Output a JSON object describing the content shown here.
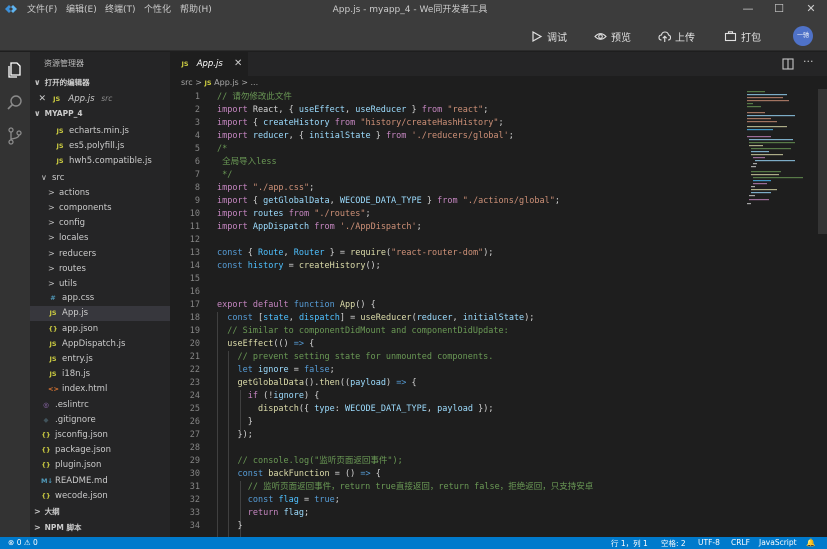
{
  "titlebar": {
    "menus": [
      "文件(F)",
      "编辑(E)",
      "终端(T)",
      "个性化",
      "帮助(H)"
    ],
    "title": "App.js - myapp_4 - We同开发者工具"
  },
  "toolbar": {
    "debug_label": "调试",
    "preview_label": "预览",
    "upload_label": "上传",
    "package_label": "打包",
    "avatar_text": "一驰"
  },
  "sidebar": {
    "title": "资源管理器",
    "open_editors_label": "打开的编辑器",
    "open_editor_file": "App.js",
    "open_editor_folder": "src",
    "project_label": "MYAPP_4",
    "files": [
      {
        "name": "echarts.min.js",
        "icon": "JS",
        "kind": "js",
        "indent": 3,
        "chevron": ""
      },
      {
        "name": "es5.polyfill.js",
        "icon": "JS",
        "kind": "js",
        "indent": 3,
        "chevron": ""
      },
      {
        "name": "hwh5.compatible.js",
        "icon": "JS",
        "kind": "js",
        "indent": 3,
        "chevron": ""
      },
      {
        "name": "src",
        "icon": "",
        "kind": "folder",
        "indent": 1,
        "chevron": "∨"
      },
      {
        "name": "actions",
        "icon": "",
        "kind": "folder",
        "indent": 2,
        "chevron": ">"
      },
      {
        "name": "components",
        "icon": "",
        "kind": "folder",
        "indent": 2,
        "chevron": ">"
      },
      {
        "name": "config",
        "icon": "",
        "kind": "folder",
        "indent": 2,
        "chevron": ">"
      },
      {
        "name": "locales",
        "icon": "",
        "kind": "folder",
        "indent": 2,
        "chevron": ">"
      },
      {
        "name": "reducers",
        "icon": "",
        "kind": "folder",
        "indent": 2,
        "chevron": ">"
      },
      {
        "name": "routes",
        "icon": "",
        "kind": "folder",
        "indent": 2,
        "chevron": ">"
      },
      {
        "name": "utils",
        "icon": "",
        "kind": "folder",
        "indent": 2,
        "chevron": ">"
      },
      {
        "name": "app.css",
        "icon": "#",
        "kind": "css",
        "indent": 2,
        "chevron": ""
      },
      {
        "name": "App.js",
        "icon": "JS",
        "kind": "js",
        "indent": 2,
        "chevron": "",
        "selected": true
      },
      {
        "name": "app.json",
        "icon": "{}",
        "kind": "json",
        "indent": 2,
        "chevron": ""
      },
      {
        "name": "AppDispatch.js",
        "icon": "JS",
        "kind": "js",
        "indent": 2,
        "chevron": ""
      },
      {
        "name": "entry.js",
        "icon": "JS",
        "kind": "js",
        "indent": 2,
        "chevron": ""
      },
      {
        "name": "i18n.js",
        "icon": "JS",
        "kind": "js",
        "indent": 2,
        "chevron": ""
      },
      {
        "name": "index.html",
        "icon": "<>",
        "kind": "html",
        "indent": 2,
        "chevron": ""
      },
      {
        "name": ".eslintrc",
        "icon": "◎",
        "kind": "eslint",
        "indent": 1,
        "chevron": ""
      },
      {
        "name": ".gitignore",
        "icon": "◆",
        "kind": "git",
        "indent": 1,
        "chevron": ""
      },
      {
        "name": "jsconfig.json",
        "icon": "{}",
        "kind": "json",
        "indent": 1,
        "chevron": ""
      },
      {
        "name": "package.json",
        "icon": "{}",
        "kind": "json",
        "indent": 1,
        "chevron": ""
      },
      {
        "name": "plugin.json",
        "icon": "{}",
        "kind": "json",
        "indent": 1,
        "chevron": ""
      },
      {
        "name": "README.md",
        "icon": "M↓",
        "kind": "md",
        "indent": 1,
        "chevron": ""
      },
      {
        "name": "wecode.json",
        "icon": "{}",
        "kind": "json",
        "indent": 1,
        "chevron": ""
      }
    ],
    "outline_label": "大纲",
    "npm_label": "NPM 脚本"
  },
  "tab": {
    "label": "App.js",
    "icon": "JS"
  },
  "breadcrumb": {
    "folder": "src",
    "file": "App.js",
    "more": "..."
  },
  "editor": {
    "start_line": 1,
    "lines": [
      [
        [
          "cm",
          "// 请勿修改此文件"
        ]
      ],
      [
        [
          "kw",
          "import"
        ],
        [
          "",
          " React, { "
        ],
        [
          "vr",
          "useEffect"
        ],
        [
          "",
          ", "
        ],
        [
          "vr",
          "useReducer"
        ],
        [
          "",
          " } "
        ],
        [
          "kw",
          "from"
        ],
        [
          "",
          " "
        ],
        [
          "st",
          "\"react\""
        ],
        [
          "",
          ";"
        ]
      ],
      [
        [
          "kw",
          "import"
        ],
        [
          "",
          " { "
        ],
        [
          "vr",
          "createHistory"
        ],
        [
          "",
          " "
        ],
        [
          "kw",
          "from"
        ],
        [
          "",
          " "
        ],
        [
          "st",
          "\"history/createHashHistory\""
        ],
        [
          "",
          ";"
        ]
      ],
      [
        [
          "kw",
          "import"
        ],
        [
          "",
          " "
        ],
        [
          "vr",
          "reducer"
        ],
        [
          "",
          ", { "
        ],
        [
          "vr",
          "initialState"
        ],
        [
          "",
          " } "
        ],
        [
          "kw",
          "from"
        ],
        [
          "",
          " "
        ],
        [
          "st",
          "'./reducers/global'"
        ],
        [
          "",
          ";"
        ]
      ],
      [
        [
          "cm",
          "/*"
        ]
      ],
      [
        [
          "cm",
          " 全局导入less"
        ]
      ],
      [
        [
          "cm",
          " */"
        ]
      ],
      [
        [
          "kw",
          "import"
        ],
        [
          "",
          " "
        ],
        [
          "st",
          "\"./app.css\""
        ],
        [
          "",
          ";"
        ]
      ],
      [
        [
          "kw",
          "import"
        ],
        [
          "",
          " { "
        ],
        [
          "vr",
          "getGlobalData"
        ],
        [
          "",
          ", "
        ],
        [
          "vr",
          "WECODE_DATA_TYPE"
        ],
        [
          "",
          " } "
        ],
        [
          "kw",
          "from"
        ],
        [
          "",
          " "
        ],
        [
          "st",
          "\"./actions/global\""
        ],
        [
          "",
          ";"
        ]
      ],
      [
        [
          "kw",
          "import"
        ],
        [
          "",
          " "
        ],
        [
          "vr",
          "routes"
        ],
        [
          "",
          " "
        ],
        [
          "kw",
          "from"
        ],
        [
          "",
          " "
        ],
        [
          "st",
          "\"./routes\""
        ],
        [
          "",
          ";"
        ]
      ],
      [
        [
          "kw",
          "import"
        ],
        [
          "",
          " "
        ],
        [
          "vr",
          "AppDispatch"
        ],
        [
          "",
          " "
        ],
        [
          "kw",
          "from"
        ],
        [
          "",
          " "
        ],
        [
          "st",
          "'./AppDispatch'"
        ],
        [
          "",
          ";"
        ]
      ],
      [],
      [
        [
          "bl",
          "const"
        ],
        [
          "",
          " { "
        ],
        [
          "cn",
          "Route"
        ],
        [
          "",
          ", "
        ],
        [
          "cn",
          "Router"
        ],
        [
          "",
          " } = "
        ],
        [
          "fn",
          "require"
        ],
        [
          "",
          "("
        ],
        [
          "st",
          "\"react-router-dom\""
        ],
        [
          "",
          ");"
        ]
      ],
      [
        [
          "bl",
          "const"
        ],
        [
          "",
          " "
        ],
        [
          "cn",
          "history"
        ],
        [
          "",
          " = "
        ],
        [
          "fn",
          "createHistory"
        ],
        [
          "",
          "();"
        ]
      ],
      [],
      [],
      [
        [
          "kw",
          "export"
        ],
        [
          "",
          " "
        ],
        [
          "kw",
          "default"
        ],
        [
          "",
          " "
        ],
        [
          "bl",
          "function"
        ],
        [
          "",
          " "
        ],
        [
          "fn",
          "App"
        ],
        [
          "",
          "() {"
        ]
      ],
      [
        [
          "",
          "  "
        ],
        [
          "bl",
          "const"
        ],
        [
          "",
          " ["
        ],
        [
          "cn",
          "state"
        ],
        [
          "",
          ", "
        ],
        [
          "cn",
          "dispatch"
        ],
        [
          "",
          "] = "
        ],
        [
          "fn",
          "useReducer"
        ],
        [
          "",
          "("
        ],
        [
          "vr",
          "reducer"
        ],
        [
          "",
          ", "
        ],
        [
          "vr",
          "initialState"
        ],
        [
          "",
          ");"
        ]
      ],
      [
        [
          "",
          "  "
        ],
        [
          "cm",
          "// Similar to componentDidMount and componentDidUpdate:"
        ]
      ],
      [
        [
          "",
          "  "
        ],
        [
          "fn",
          "useEffect"
        ],
        [
          "",
          "(() "
        ],
        [
          "bl",
          "=>"
        ],
        [
          "",
          " {"
        ]
      ],
      [
        [
          "",
          "    "
        ],
        [
          "cm",
          "// prevent setting state for unmounted components."
        ]
      ],
      [
        [
          "",
          "    "
        ],
        [
          "bl",
          "let"
        ],
        [
          "",
          " "
        ],
        [
          "vr",
          "ignore"
        ],
        [
          "",
          " = "
        ],
        [
          "bl",
          "false"
        ],
        [
          "",
          ";"
        ]
      ],
      [
        [
          "",
          "    "
        ],
        [
          "fn",
          "getGlobalData"
        ],
        [
          "",
          "()."
        ],
        [
          "fn",
          "then"
        ],
        [
          "",
          "(("
        ],
        [
          "vr",
          "payload"
        ],
        [
          "",
          ") "
        ],
        [
          "bl",
          "=>"
        ],
        [
          "",
          " {"
        ]
      ],
      [
        [
          "",
          "      "
        ],
        [
          "kw",
          "if"
        ],
        [
          "",
          " (!"
        ],
        [
          "vr",
          "ignore"
        ],
        [
          "",
          ") {"
        ]
      ],
      [
        [
          "",
          "        "
        ],
        [
          "fn",
          "dispatch"
        ],
        [
          "",
          "({ "
        ],
        [
          "vr",
          "type"
        ],
        [
          "",
          ": "
        ],
        [
          "vr",
          "WECODE_DATA_TYPE"
        ],
        [
          "",
          ", "
        ],
        [
          "vr",
          "payload"
        ],
        [
          "",
          " });"
        ]
      ],
      [
        [
          "",
          "      }"
        ]
      ],
      [
        [
          "",
          "    });"
        ]
      ],
      [],
      [
        [
          "",
          "    "
        ],
        [
          "cm",
          "// console.log(\"监听页面返回事件\");"
        ]
      ],
      [
        [
          "",
          "    "
        ],
        [
          "bl",
          "const"
        ],
        [
          "",
          " "
        ],
        [
          "fn",
          "backFunction"
        ],
        [
          "",
          " = () "
        ],
        [
          "bl",
          "=>"
        ],
        [
          "",
          " {"
        ]
      ],
      [
        [
          "",
          "      "
        ],
        [
          "cm",
          "// 监听页面返回事件，return true直接返回，return false，拒绝返回，只支持安卓"
        ]
      ],
      [
        [
          "",
          "      "
        ],
        [
          "bl",
          "const"
        ],
        [
          "",
          " "
        ],
        [
          "cn",
          "flag"
        ],
        [
          "",
          " = "
        ],
        [
          "bl",
          "true"
        ],
        [
          "",
          ";"
        ]
      ],
      [
        [
          "",
          "      "
        ],
        [
          "kw",
          "return"
        ],
        [
          "",
          " "
        ],
        [
          "vr",
          "flag"
        ],
        [
          "",
          ";"
        ]
      ],
      [
        [
          "",
          "    }"
        ]
      ]
    ]
  },
  "statusbar": {
    "errors": "0",
    "warnings": "0",
    "position": "行 1，列 1",
    "spaces": "空格: 2",
    "encoding": "UTF-8",
    "eol": "CRLF",
    "language": "JavaScript"
  },
  "colors": {
    "accent": "#007acc",
    "titlebar": "#3c3c3c",
    "sidebar": "#252526",
    "editor": "#1e1e1e"
  }
}
